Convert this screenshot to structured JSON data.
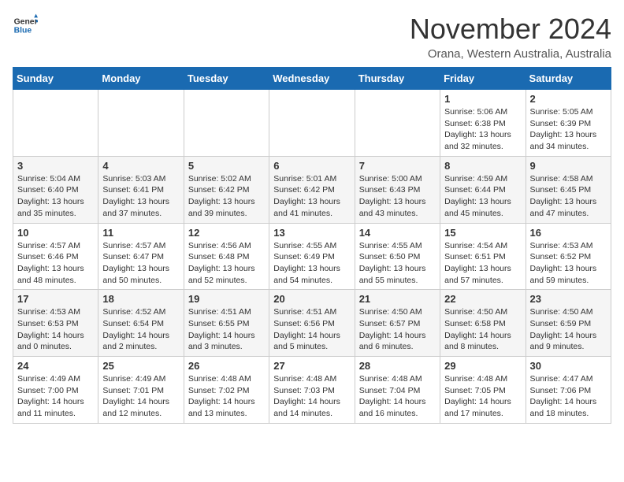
{
  "header": {
    "logo_line1": "General",
    "logo_line2": "Blue",
    "month_title": "November 2024",
    "location": "Orana, Western Australia, Australia"
  },
  "weekdays": [
    "Sunday",
    "Monday",
    "Tuesday",
    "Wednesday",
    "Thursday",
    "Friday",
    "Saturday"
  ],
  "weeks": [
    [
      {
        "day": "",
        "info": ""
      },
      {
        "day": "",
        "info": ""
      },
      {
        "day": "",
        "info": ""
      },
      {
        "day": "",
        "info": ""
      },
      {
        "day": "",
        "info": ""
      },
      {
        "day": "1",
        "info": "Sunrise: 5:06 AM\nSunset: 6:38 PM\nDaylight: 13 hours\nand 32 minutes."
      },
      {
        "day": "2",
        "info": "Sunrise: 5:05 AM\nSunset: 6:39 PM\nDaylight: 13 hours\nand 34 minutes."
      }
    ],
    [
      {
        "day": "3",
        "info": "Sunrise: 5:04 AM\nSunset: 6:40 PM\nDaylight: 13 hours\nand 35 minutes."
      },
      {
        "day": "4",
        "info": "Sunrise: 5:03 AM\nSunset: 6:41 PM\nDaylight: 13 hours\nand 37 minutes."
      },
      {
        "day": "5",
        "info": "Sunrise: 5:02 AM\nSunset: 6:42 PM\nDaylight: 13 hours\nand 39 minutes."
      },
      {
        "day": "6",
        "info": "Sunrise: 5:01 AM\nSunset: 6:42 PM\nDaylight: 13 hours\nand 41 minutes."
      },
      {
        "day": "7",
        "info": "Sunrise: 5:00 AM\nSunset: 6:43 PM\nDaylight: 13 hours\nand 43 minutes."
      },
      {
        "day": "8",
        "info": "Sunrise: 4:59 AM\nSunset: 6:44 PM\nDaylight: 13 hours\nand 45 minutes."
      },
      {
        "day": "9",
        "info": "Sunrise: 4:58 AM\nSunset: 6:45 PM\nDaylight: 13 hours\nand 47 minutes."
      }
    ],
    [
      {
        "day": "10",
        "info": "Sunrise: 4:57 AM\nSunset: 6:46 PM\nDaylight: 13 hours\nand 48 minutes."
      },
      {
        "day": "11",
        "info": "Sunrise: 4:57 AM\nSunset: 6:47 PM\nDaylight: 13 hours\nand 50 minutes."
      },
      {
        "day": "12",
        "info": "Sunrise: 4:56 AM\nSunset: 6:48 PM\nDaylight: 13 hours\nand 52 minutes."
      },
      {
        "day": "13",
        "info": "Sunrise: 4:55 AM\nSunset: 6:49 PM\nDaylight: 13 hours\nand 54 minutes."
      },
      {
        "day": "14",
        "info": "Sunrise: 4:55 AM\nSunset: 6:50 PM\nDaylight: 13 hours\nand 55 minutes."
      },
      {
        "day": "15",
        "info": "Sunrise: 4:54 AM\nSunset: 6:51 PM\nDaylight: 13 hours\nand 57 minutes."
      },
      {
        "day": "16",
        "info": "Sunrise: 4:53 AM\nSunset: 6:52 PM\nDaylight: 13 hours\nand 59 minutes."
      }
    ],
    [
      {
        "day": "17",
        "info": "Sunrise: 4:53 AM\nSunset: 6:53 PM\nDaylight: 14 hours\nand 0 minutes."
      },
      {
        "day": "18",
        "info": "Sunrise: 4:52 AM\nSunset: 6:54 PM\nDaylight: 14 hours\nand 2 minutes."
      },
      {
        "day": "19",
        "info": "Sunrise: 4:51 AM\nSunset: 6:55 PM\nDaylight: 14 hours\nand 3 minutes."
      },
      {
        "day": "20",
        "info": "Sunrise: 4:51 AM\nSunset: 6:56 PM\nDaylight: 14 hours\nand 5 minutes."
      },
      {
        "day": "21",
        "info": "Sunrise: 4:50 AM\nSunset: 6:57 PM\nDaylight: 14 hours\nand 6 minutes."
      },
      {
        "day": "22",
        "info": "Sunrise: 4:50 AM\nSunset: 6:58 PM\nDaylight: 14 hours\nand 8 minutes."
      },
      {
        "day": "23",
        "info": "Sunrise: 4:50 AM\nSunset: 6:59 PM\nDaylight: 14 hours\nand 9 minutes."
      }
    ],
    [
      {
        "day": "24",
        "info": "Sunrise: 4:49 AM\nSunset: 7:00 PM\nDaylight: 14 hours\nand 11 minutes."
      },
      {
        "day": "25",
        "info": "Sunrise: 4:49 AM\nSunset: 7:01 PM\nDaylight: 14 hours\nand 12 minutes."
      },
      {
        "day": "26",
        "info": "Sunrise: 4:48 AM\nSunset: 7:02 PM\nDaylight: 14 hours\nand 13 minutes."
      },
      {
        "day": "27",
        "info": "Sunrise: 4:48 AM\nSunset: 7:03 PM\nDaylight: 14 hours\nand 14 minutes."
      },
      {
        "day": "28",
        "info": "Sunrise: 4:48 AM\nSunset: 7:04 PM\nDaylight: 14 hours\nand 16 minutes."
      },
      {
        "day": "29",
        "info": "Sunrise: 4:48 AM\nSunset: 7:05 PM\nDaylight: 14 hours\nand 17 minutes."
      },
      {
        "day": "30",
        "info": "Sunrise: 4:47 AM\nSunset: 7:06 PM\nDaylight: 14 hours\nand 18 minutes."
      }
    ]
  ]
}
